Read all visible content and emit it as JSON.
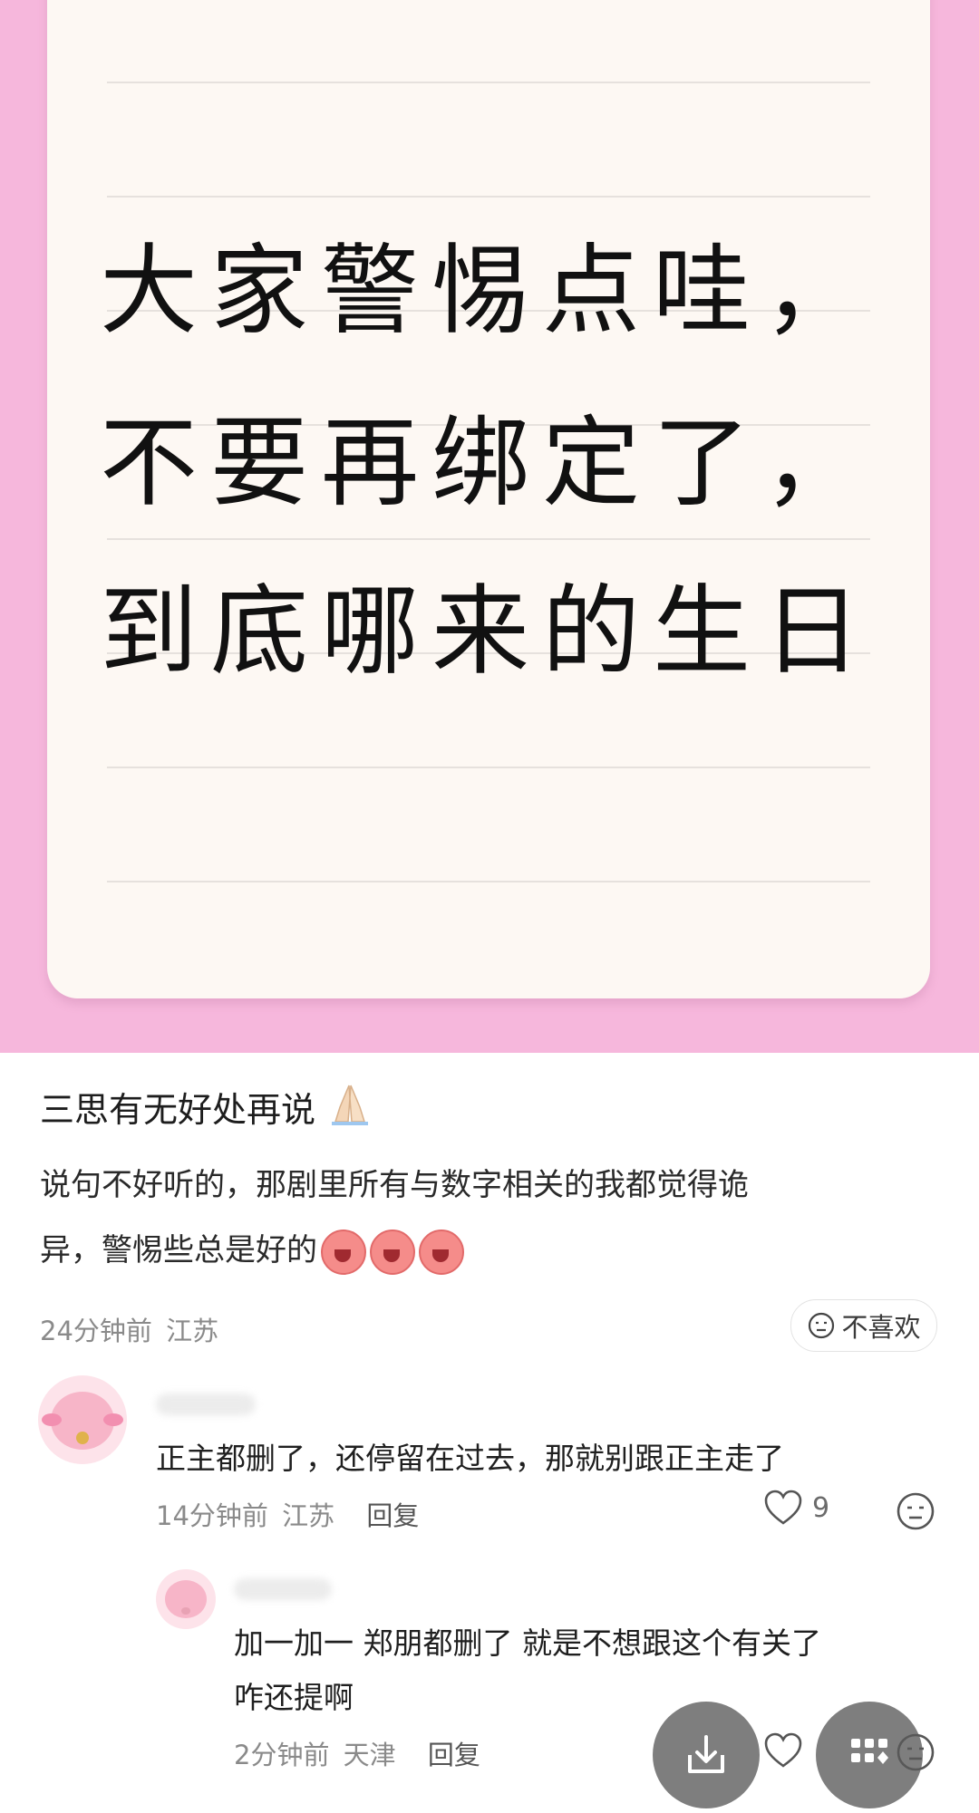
{
  "image_card": {
    "lines": [
      "大家警惕点哇，",
      "不要再绑定了，",
      "到底哪来的生日"
    ]
  },
  "post": {
    "title": "三思有无好处再说",
    "body_line1": "说句不好听的，那剧里所有与数字相关的我都觉得诡",
    "body_line2": "异，警惕些总是好的",
    "time": "24分钟前",
    "location": "江苏",
    "dislike_label": "不喜欢"
  },
  "reply1": {
    "text": "正主都删了，还停留在过去，那就别跟正主走了",
    "time": "14分钟前",
    "location": "江苏",
    "reply_label": "回复",
    "likes": "9"
  },
  "reply2": {
    "text_line1": "加一加一 郑朋都删了 就是不想跟这个有关了",
    "text_line2": "咋还提啊",
    "time": "2分钟前",
    "location": "天津",
    "reply_label": "回复"
  },
  "colors": {
    "hero_bg": "#f6b7dc",
    "card_bg": "#fdf8f3"
  }
}
